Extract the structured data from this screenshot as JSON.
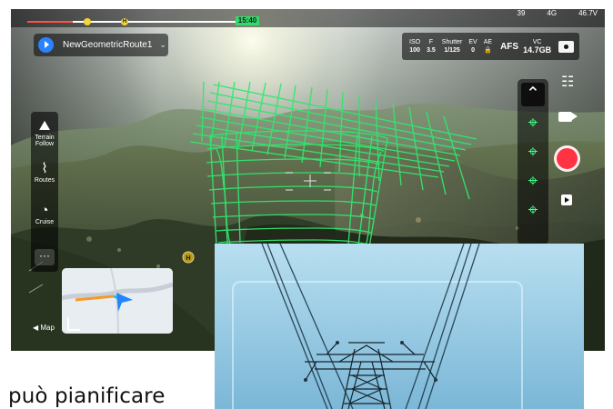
{
  "status_bar": {
    "time": "15:40",
    "signal_left": "39",
    "signal_mid": "4G",
    "battery": "46.7V"
  },
  "route": {
    "name": "NewGeometricRoute1",
    "chevron": "⌄"
  },
  "camera": {
    "iso_label": "ISO",
    "iso_value": "100",
    "f_label": "F",
    "f_value": "3.5",
    "shutter_label": "Shutter",
    "shutter_value": "1/125",
    "ev_label": "EV",
    "ev_value": "0",
    "ae_label": "AE",
    "ae_value": "🔒",
    "afs_label": "AFS",
    "storage_label": "VC",
    "storage_value": "14.7GB"
  },
  "left_tools": {
    "terrain_follow_label": "Terrain Follow",
    "routes_label": "Routes",
    "cruise_label": "Cruise",
    "more_label": "···"
  },
  "map": {
    "label": "◀ Map"
  },
  "right_tools": {
    "active_icon": "⌃",
    "waypoint_icon": "⌖",
    "settings_icon": "☷"
  },
  "caption": {
    "text": "può pianificare"
  },
  "colors": {
    "route_green": "#33e66f",
    "accent_blue": "#2a82ff",
    "record_red": "#ff3341"
  },
  "icons": {
    "play": "play-icon",
    "camera": "camera-icon",
    "settings": "settings-icon",
    "video": "video-icon",
    "record": "record-icon",
    "playback": "playback-icon"
  }
}
